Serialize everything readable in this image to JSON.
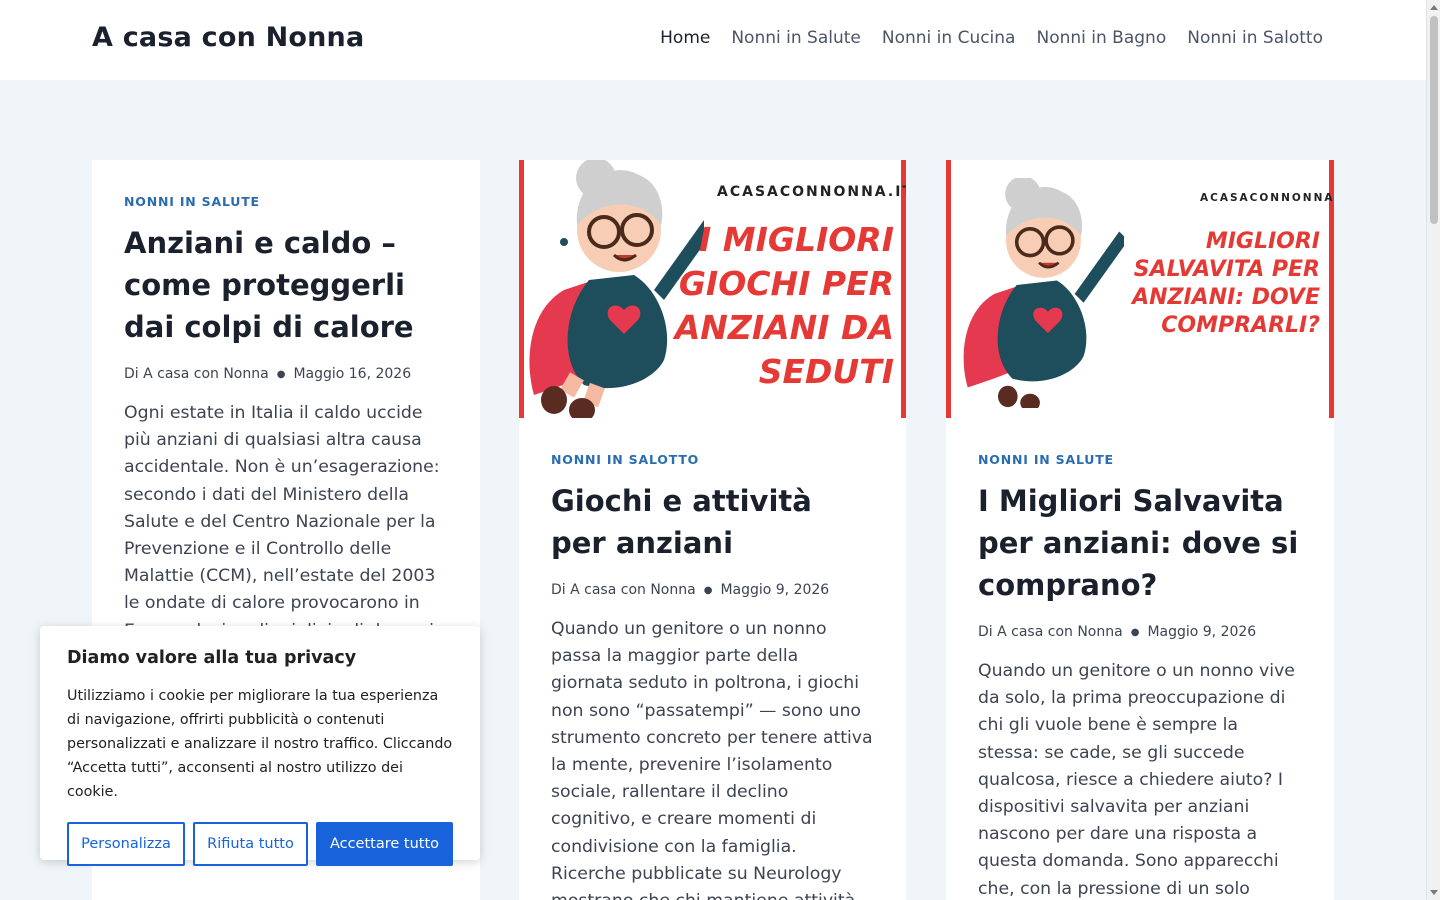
{
  "header": {
    "site_title": "A casa con Nonna",
    "nav": [
      {
        "label": "Home",
        "active": true
      },
      {
        "label": "Nonni in Salute"
      },
      {
        "label": "Nonni in Cucina"
      },
      {
        "label": "Nonni in Bagno"
      },
      {
        "label": "Nonni in Salotto"
      }
    ]
  },
  "posts": [
    {
      "category": "NONNI IN SALUTE",
      "title": "Anziani e caldo – come proteggerli dai colpi di calore",
      "author": "Di A casa con Nonna",
      "date": "Maggio 16, 2026",
      "excerpt": "Ogni estate in Italia il caldo uccide più anziani di qualsiasi altra causa accidentale. Non è un’esagerazione: secondo i dati del Ministero della Salute e del Centro Nazionale per la Prevenzione e il Controllo delle Malattie (CCM), nell’estate del 2003 le ondate di calore provocarono in Europa decine di migliaia di decessi"
    },
    {
      "image": {
        "brand": "ACASACONNONNA.IT",
        "headline": "I MIGLIORI GIOCHI PER ANZIANI DA SEDUTI"
      },
      "category": "NONNI IN SALOTTO",
      "title": "Giochi e attività per anziani",
      "author": "Di A casa con Nonna",
      "date": "Maggio 9, 2026",
      "excerpt": "Quando un genitore o un nonno passa la maggior parte della giornata seduto in poltrona, i giochi non sono “passatempi” — sono uno strumento concreto per tenere attiva la mente, prevenire l’isolamento sociale, rallentare il declino cognitivo, e creare momenti di condivisione con la famiglia. Ricerche pubblicate su Neurology mostrano che chi mantiene attività cognitive…"
    },
    {
      "image": {
        "brand": "ACASACONNONNA.IT",
        "headline": "MIGLIORI SALVAVITA PER ANZIANI: DOVE COMPRARLI?"
      },
      "category": "NONNI IN SALUTE",
      "title": "I Migliori Salvavita per anziani: dove si comprano?",
      "author": "Di A casa con Nonna",
      "date": "Maggio 9, 2026",
      "excerpt": "Quando un genitore o un nonno vive da solo, la prima preoccupazione di chi gli vuole bene è sempre la stessa: se cade, se gli succede qualcosa, riesce a chiedere aiuto? I dispositivi salvavita per anziani nascono per dare una risposta a questa domanda. Sono apparecchi che, con la pressione di un solo tasto,"
    }
  ],
  "cookie_banner": {
    "title": "Diamo valore alla tua privacy",
    "text": "Utilizziamo i cookie per migliorare la tua esperienza di navigazione, offrirti pubblicità o contenuti personalizzati e analizzare il nostro traffico. Cliccando “Accetta tutti”, acconsenti al nostro utilizzo dei cookie.",
    "customize_label": "Personalizza",
    "reject_label": "Rifiuta tutto",
    "accept_label": "Accettare tutto"
  },
  "colors": {
    "accent": "#2b6cb0",
    "cookie_button": "#1863dc",
    "image_red": "#e53935",
    "background": "#f0f5fa"
  }
}
